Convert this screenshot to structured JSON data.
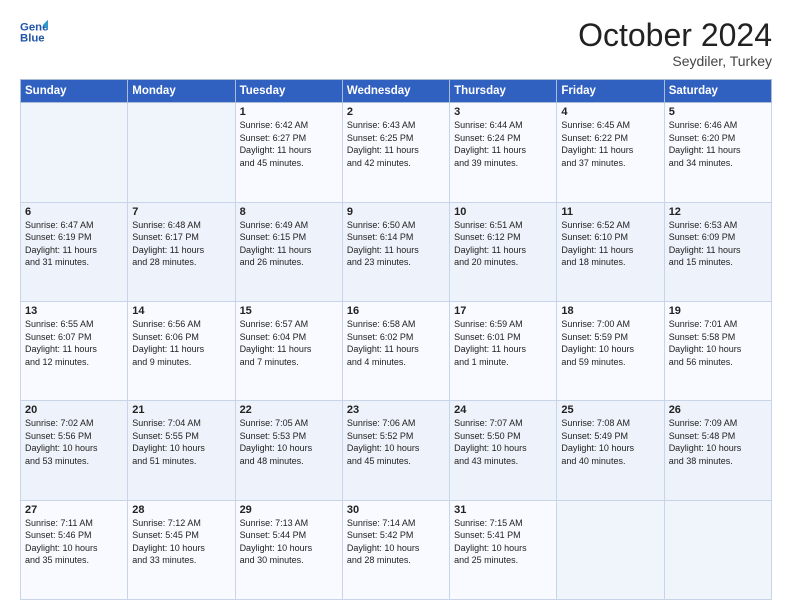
{
  "header": {
    "logo_line1": "General",
    "logo_line2": "Blue",
    "month": "October 2024",
    "location": "Seydiler, Turkey"
  },
  "weekdays": [
    "Sunday",
    "Monday",
    "Tuesday",
    "Wednesday",
    "Thursday",
    "Friday",
    "Saturday"
  ],
  "weeks": [
    [
      {
        "day": "",
        "info": ""
      },
      {
        "day": "",
        "info": ""
      },
      {
        "day": "1",
        "info": "Sunrise: 6:42 AM\nSunset: 6:27 PM\nDaylight: 11 hours\nand 45 minutes."
      },
      {
        "day": "2",
        "info": "Sunrise: 6:43 AM\nSunset: 6:25 PM\nDaylight: 11 hours\nand 42 minutes."
      },
      {
        "day": "3",
        "info": "Sunrise: 6:44 AM\nSunset: 6:24 PM\nDaylight: 11 hours\nand 39 minutes."
      },
      {
        "day": "4",
        "info": "Sunrise: 6:45 AM\nSunset: 6:22 PM\nDaylight: 11 hours\nand 37 minutes."
      },
      {
        "day": "5",
        "info": "Sunrise: 6:46 AM\nSunset: 6:20 PM\nDaylight: 11 hours\nand 34 minutes."
      }
    ],
    [
      {
        "day": "6",
        "info": "Sunrise: 6:47 AM\nSunset: 6:19 PM\nDaylight: 11 hours\nand 31 minutes."
      },
      {
        "day": "7",
        "info": "Sunrise: 6:48 AM\nSunset: 6:17 PM\nDaylight: 11 hours\nand 28 minutes."
      },
      {
        "day": "8",
        "info": "Sunrise: 6:49 AM\nSunset: 6:15 PM\nDaylight: 11 hours\nand 26 minutes."
      },
      {
        "day": "9",
        "info": "Sunrise: 6:50 AM\nSunset: 6:14 PM\nDaylight: 11 hours\nand 23 minutes."
      },
      {
        "day": "10",
        "info": "Sunrise: 6:51 AM\nSunset: 6:12 PM\nDaylight: 11 hours\nand 20 minutes."
      },
      {
        "day": "11",
        "info": "Sunrise: 6:52 AM\nSunset: 6:10 PM\nDaylight: 11 hours\nand 18 minutes."
      },
      {
        "day": "12",
        "info": "Sunrise: 6:53 AM\nSunset: 6:09 PM\nDaylight: 11 hours\nand 15 minutes."
      }
    ],
    [
      {
        "day": "13",
        "info": "Sunrise: 6:55 AM\nSunset: 6:07 PM\nDaylight: 11 hours\nand 12 minutes."
      },
      {
        "day": "14",
        "info": "Sunrise: 6:56 AM\nSunset: 6:06 PM\nDaylight: 11 hours\nand 9 minutes."
      },
      {
        "day": "15",
        "info": "Sunrise: 6:57 AM\nSunset: 6:04 PM\nDaylight: 11 hours\nand 7 minutes."
      },
      {
        "day": "16",
        "info": "Sunrise: 6:58 AM\nSunset: 6:02 PM\nDaylight: 11 hours\nand 4 minutes."
      },
      {
        "day": "17",
        "info": "Sunrise: 6:59 AM\nSunset: 6:01 PM\nDaylight: 11 hours\nand 1 minute."
      },
      {
        "day": "18",
        "info": "Sunrise: 7:00 AM\nSunset: 5:59 PM\nDaylight: 10 hours\nand 59 minutes."
      },
      {
        "day": "19",
        "info": "Sunrise: 7:01 AM\nSunset: 5:58 PM\nDaylight: 10 hours\nand 56 minutes."
      }
    ],
    [
      {
        "day": "20",
        "info": "Sunrise: 7:02 AM\nSunset: 5:56 PM\nDaylight: 10 hours\nand 53 minutes."
      },
      {
        "day": "21",
        "info": "Sunrise: 7:04 AM\nSunset: 5:55 PM\nDaylight: 10 hours\nand 51 minutes."
      },
      {
        "day": "22",
        "info": "Sunrise: 7:05 AM\nSunset: 5:53 PM\nDaylight: 10 hours\nand 48 minutes."
      },
      {
        "day": "23",
        "info": "Sunrise: 7:06 AM\nSunset: 5:52 PM\nDaylight: 10 hours\nand 45 minutes."
      },
      {
        "day": "24",
        "info": "Sunrise: 7:07 AM\nSunset: 5:50 PM\nDaylight: 10 hours\nand 43 minutes."
      },
      {
        "day": "25",
        "info": "Sunrise: 7:08 AM\nSunset: 5:49 PM\nDaylight: 10 hours\nand 40 minutes."
      },
      {
        "day": "26",
        "info": "Sunrise: 7:09 AM\nSunset: 5:48 PM\nDaylight: 10 hours\nand 38 minutes."
      }
    ],
    [
      {
        "day": "27",
        "info": "Sunrise: 7:11 AM\nSunset: 5:46 PM\nDaylight: 10 hours\nand 35 minutes."
      },
      {
        "day": "28",
        "info": "Sunrise: 7:12 AM\nSunset: 5:45 PM\nDaylight: 10 hours\nand 33 minutes."
      },
      {
        "day": "29",
        "info": "Sunrise: 7:13 AM\nSunset: 5:44 PM\nDaylight: 10 hours\nand 30 minutes."
      },
      {
        "day": "30",
        "info": "Sunrise: 7:14 AM\nSunset: 5:42 PM\nDaylight: 10 hours\nand 28 minutes."
      },
      {
        "day": "31",
        "info": "Sunrise: 7:15 AM\nSunset: 5:41 PM\nDaylight: 10 hours\nand 25 minutes."
      },
      {
        "day": "",
        "info": ""
      },
      {
        "day": "",
        "info": ""
      }
    ]
  ]
}
